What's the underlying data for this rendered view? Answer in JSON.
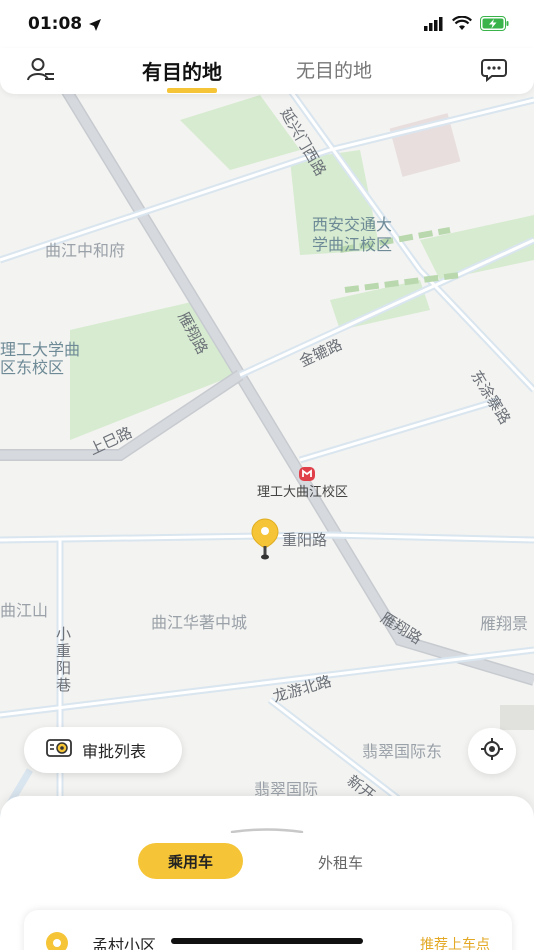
{
  "status_bar": {
    "time": "01:08"
  },
  "header": {
    "tabs": [
      {
        "label": "有目的地",
        "active": true
      },
      {
        "label": "无目的地",
        "active": false
      }
    ]
  },
  "map": {
    "labels": {
      "yanxing_west": "延兴门西路",
      "xjtu": "西安交通大",
      "xjtu2": "学曲江校区",
      "qujiang_zhonghe": "曲江中和府",
      "yanxiang_road_1": "雁翔路",
      "jinlu_road": "金辘路",
      "ligong_east": "理工大学曲",
      "ligong_east2": "区东校区",
      "shangsi_road": "上巳路",
      "dongdian_road": "东涂寨路",
      "pin_label": "理工大曲江校区",
      "chongyang_road": "重阳路",
      "qujiang_shan": "曲江山",
      "qujiang_huazhu": "曲江华著中城",
      "yanxiang_road_2": "雁翔路",
      "yanxiang_jing": "雁翔景",
      "xiao_chongyang": "小重阳巷",
      "longyou_north": "龙游北路",
      "feicui_east": "翡翠国际东",
      "feicui": "翡翠国际",
      "xinkai": "新开"
    }
  },
  "approval_button": {
    "label": "审批列表"
  },
  "sheet": {
    "car_tabs": [
      {
        "label": "乘用车",
        "active": true
      },
      {
        "label": "外租车",
        "active": false
      }
    ],
    "pickup": {
      "location": "孟村小区",
      "recommend": "推荐上车点"
    }
  },
  "colors": {
    "accent": "#f5c537",
    "recommend": "#e3a825"
  }
}
